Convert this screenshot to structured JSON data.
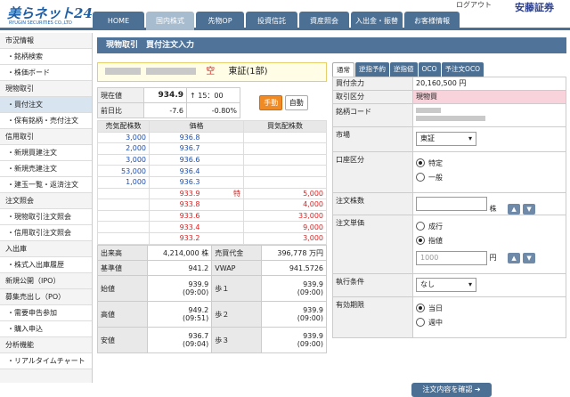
{
  "brand": {
    "logo": "美らネット24",
    "sub": "RYUGIN SECURITIES CO.,LTD"
  },
  "header": {
    "logout": "ログアウト",
    "user": "安藤証券"
  },
  "nav": [
    "HOME",
    "国内株式",
    "先物OP",
    "投資信託",
    "資産照会",
    "入出金・振替",
    "お客様情報"
  ],
  "sidebar": [
    {
      "t": "cat",
      "label": "市況情報"
    },
    {
      "t": "item",
      "label": "・銘柄検索"
    },
    {
      "t": "item",
      "label": "・株価ボード"
    },
    {
      "t": "cat",
      "label": "現物取引"
    },
    {
      "t": "item",
      "label": "・買付注文",
      "active": true
    },
    {
      "t": "item",
      "label": "・保有銘柄・売付注文"
    },
    {
      "t": "cat",
      "label": "信用取引"
    },
    {
      "t": "item",
      "label": "・新規買建注文"
    },
    {
      "t": "item",
      "label": "・新規売建注文"
    },
    {
      "t": "item",
      "label": "・建玉一覧・返済注文"
    },
    {
      "t": "cat",
      "label": "注文照会"
    },
    {
      "t": "item",
      "label": "・現物取引注文照会"
    },
    {
      "t": "item",
      "label": "・信用取引注文照会"
    },
    {
      "t": "cat",
      "label": "入出庫"
    },
    {
      "t": "item",
      "label": "・株式入出庫履歴"
    },
    {
      "t": "cat",
      "label": "新規公開（IPO）"
    },
    {
      "t": "cat",
      "label": "募集売出し（PO）"
    },
    {
      "t": "item",
      "label": "・需要申告参加"
    },
    {
      "t": "item",
      "label": "・購入申込"
    },
    {
      "t": "cat",
      "label": "分析機能"
    },
    {
      "t": "item",
      "label": "・リアルタイムチャート"
    }
  ],
  "page": {
    "title": "現物取引　買付注文入力"
  },
  "stock": {
    "mark": "空",
    "market": "東証(1部)"
  },
  "quote": {
    "price_label": "現在値",
    "price": "934.9",
    "arrow": "↑",
    "time": "15：00",
    "prev_label": "前日比",
    "change": "-7.6",
    "change_pct": "-0.80%",
    "manual": "手動",
    "auto": "自動"
  },
  "board": {
    "headers": [
      "売気配株数",
      "価格",
      "買気配株数"
    ],
    "rows": [
      {
        "sell": "3,000",
        "price": "936.8",
        "buy": "",
        "mark": "",
        "c": "blue"
      },
      {
        "sell": "2,000",
        "price": "936.7",
        "buy": "",
        "mark": "",
        "c": "blue"
      },
      {
        "sell": "3,000",
        "price": "936.6",
        "buy": "",
        "mark": "",
        "c": "blue"
      },
      {
        "sell": "53,000",
        "price": "936.4",
        "buy": "",
        "mark": "",
        "c": "blue"
      },
      {
        "sell": "1,000",
        "price": "936.3",
        "buy": "",
        "mark": "",
        "c": "blue"
      },
      {
        "sell": "",
        "price": "933.9",
        "buy": "5,000",
        "mark": "特",
        "c": "red"
      },
      {
        "sell": "",
        "price": "933.8",
        "buy": "4,000",
        "mark": "",
        "c": "red"
      },
      {
        "sell": "",
        "price": "933.6",
        "buy": "33,000",
        "mark": "",
        "c": "red"
      },
      {
        "sell": "",
        "price": "933.4",
        "buy": "9,000",
        "mark": "",
        "c": "red"
      },
      {
        "sell": "",
        "price": "933.2",
        "buy": "3,000",
        "mark": "",
        "c": "red"
      }
    ]
  },
  "stats": {
    "volume_label": "出来高",
    "volume": "4,214,000",
    "volume_unit": "株",
    "value_label": "売買代金",
    "value": "396,778",
    "value_unit": "万円",
    "base_label": "基準値",
    "base": "941.2",
    "vwap_label": "VWAP",
    "vwap": "941.5726",
    "open_label": "始値",
    "open": "939.9",
    "open_time": "(09:00)",
    "step1_label": "歩１",
    "step1": "939.9",
    "step1_time": "(09:00)",
    "high_label": "高値",
    "high": "949.2",
    "high_time": "(09:51)",
    "step2_label": "歩２",
    "step2": "939.9",
    "step2_time": "(09:00)",
    "low_label": "安値",
    "low": "936.7",
    "low_time": "(09:04)",
    "step3_label": "歩３",
    "step3": "939.9",
    "step3_time": "(09:00)"
  },
  "order_tabs": [
    "通常",
    "逆指予約",
    "逆指値",
    "OCO",
    "予注文OCO"
  ],
  "form": {
    "power_label": "買付余力",
    "power": "20,160,500 円",
    "type_label": "取引区分",
    "type": "現物買",
    "code_label": "銘柄コード",
    "market_label": "市場",
    "market": "東証",
    "account_label": "口座区分",
    "acc1": "特定",
    "acc2": "一般",
    "qty_label": "注文株数",
    "qty_unit": "株",
    "price_label": "注文単価",
    "p1": "成行",
    "p2": "指値",
    "price_ph": "1000",
    "price_unit": "円",
    "cond_label": "執行条件",
    "cond": "なし",
    "exp_label": "有効期限",
    "e1": "当日",
    "e2": "週中",
    "confirm": "注文内容を確認"
  }
}
